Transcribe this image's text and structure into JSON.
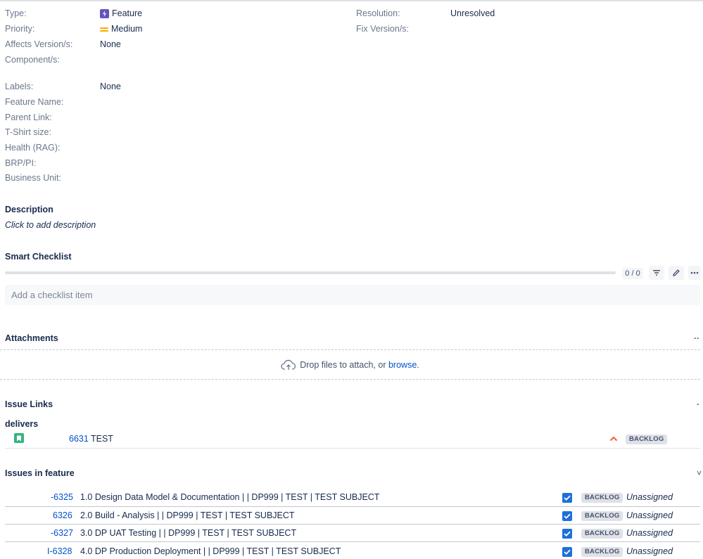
{
  "fields": {
    "type_label": "Type:",
    "type_value": "Feature",
    "priority_label": "Priority:",
    "priority_value": "Medium",
    "affects_label": "Affects Version/s:",
    "affects_value": "None",
    "component_label": "Component/s:",
    "resolution_label": "Resolution:",
    "resolution_value": "Unresolved",
    "fix_label": "Fix Version/s:",
    "labels_label": "Labels:",
    "labels_value": "None",
    "feature_name_label": "Feature Name:",
    "parent_link_label": "Parent Link:",
    "tshirt_label": "T-Shirt size:",
    "health_label": "Health (RAG):",
    "brp_label": "BRP/PI:",
    "business_unit_label": "Business Unit:"
  },
  "description": {
    "title": "Description",
    "placeholder": "Click to add description"
  },
  "checklist": {
    "title": "Smart Checklist",
    "count": "0 / 0",
    "progress": 0,
    "input_placeholder": "Add a checklist item"
  },
  "attachments": {
    "title": "Attachments",
    "drop_text": "Drop files to attach, or ",
    "browse_link": "browse",
    "drop_suffix": ".",
    "more": "··"
  },
  "issue_links": {
    "title": "Issue Links",
    "more": "·",
    "relation": "delivers",
    "link_key": "6631",
    "link_summary": "TEST",
    "link_status": "BACKLOG"
  },
  "issues_in_feature": {
    "title": "Issues in feature",
    "rows": [
      {
        "key": "-6325",
        "summary": "1.0 Design Data Model & Documentation |        | DP999 | TEST | TEST SUBJECT",
        "status": "BACKLOG",
        "assignee": "Unassigned"
      },
      {
        "key": "6326",
        "summary": "2.0 Build - Analysis |        | DP999 | TEST | TEST SUBJECT",
        "status": "BACKLOG",
        "assignee": "Unassigned"
      },
      {
        "key": "-6327",
        "summary": "3.0 DP UAT Testing |        | DP999 | TEST | TEST SUBJECT",
        "status": "BACKLOG",
        "assignee": "Unassigned"
      },
      {
        "key": "I-6328",
        "summary": "4.0 DP Production Deployment |        | DP999 | TEST | TEST SUBJECT",
        "status": "BACKLOG",
        "assignee": "Unassigned"
      }
    ]
  },
  "colors": {
    "link": "#0052cc",
    "label": "#6b778c",
    "feature_icon": "#6554c0",
    "priority_medium": "#ffab00",
    "story_icon": "#36b37e",
    "checkbox": "#1f6fdb",
    "priority_arrow": "#ff5630"
  }
}
